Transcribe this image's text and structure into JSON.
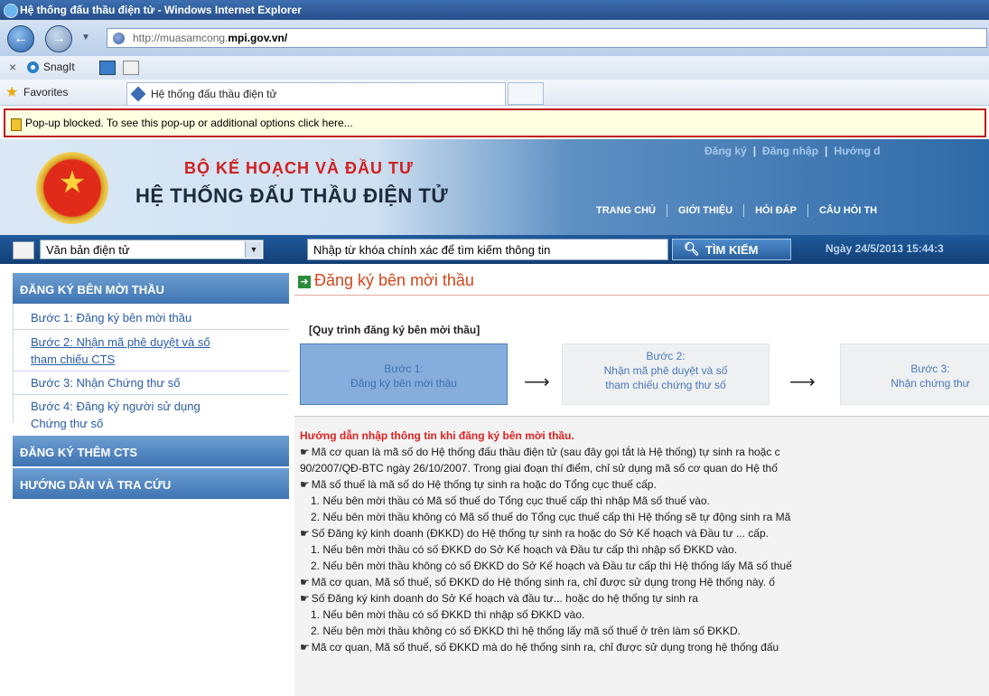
{
  "window": {
    "title": "Hệ thống đấu thầu điện tử - Windows Internet Explorer"
  },
  "address": {
    "url_prefix": "http://muasamcong.",
    "url_domain": "mpi.gov.vn/"
  },
  "toolbar": {
    "close": "×",
    "snagit": "SnagIt"
  },
  "favorites": {
    "label": "Favorites",
    "tab_title": "Hệ thống đấu thầu điện tử"
  },
  "infobar": {
    "message": "Pop-up blocked. To see this pop-up or additional options click here..."
  },
  "header": {
    "ministry": "BỘ KẾ HOẠCH VÀ ĐẦU TƯ",
    "system": "HỆ THỐNG ĐẤU THẦU ĐIỆN TỬ",
    "top_links": [
      "Đăng ký",
      "Đăng nhập",
      "Hướng d"
    ],
    "nav": [
      "TRANG CHỦ",
      "GIỚI THIỆU",
      "HỎI ĐÁP",
      "CÂU HỎI TH"
    ]
  },
  "search": {
    "doc_select": "Văn bản điện tử",
    "placeholder": "Nhập từ khóa chính xác để tìm kiếm thông tin",
    "button": "TÌM KIẾM",
    "datetime": "Ngày 24/5/2013 15:44:3"
  },
  "sidebar": {
    "section1": "ĐĂNG KÝ BÊN MỜI THẦU",
    "items": [
      "Bước 1: Đăng ký bên mời thầu",
      "Bước 2: Nhận mã phê duyệt và số",
      "tham chiếu CTS",
      "Bước 3: Nhận Chứng thư số",
      "Bước 4: Đăng ký người sử dụng",
      "Chứng thư số"
    ],
    "section2": "ĐĂNG KÝ THÊM CTS",
    "section3": "HƯỚNG DẪN VÀ TRA CỨU"
  },
  "content": {
    "title": "Đăng ký bên mời thầu",
    "process_label": "[Quy trình đăng ký bên mời thầu]",
    "steps": [
      {
        "line1": "Bước 1:",
        "line2": "Đăng ký bên mời thầu"
      },
      {
        "line1": "Bước 2:",
        "line2": "Nhận mã phê duyệt và số",
        "line3": "tham chiếu chứng thư số"
      },
      {
        "line1": "Bước 3:",
        "line2": "Nhận chứng thư"
      }
    ],
    "arrow": "⟶",
    "guide_title": "Hướng dẫn nhập thông tin khi đăng ký bên mời thầu.",
    "guide_lines": [
      "Mã cơ quan là mã số do Hệ thống đấu thầu điện tử (sau đây gọi tắt là Hệ thống) tự sinh ra hoặc c",
      "90/2007/QĐ-BTC ngày 26/10/2007. Trong giai đoạn thí điểm, chỉ sử dụng mã số cơ quan do Hệ thố",
      "Mã số thuế là mã số do Hệ thống tự sinh ra hoặc do Tổng cục thuế cấp.",
      "1. Nếu bên mời thầu có Mã số thuế do Tổng cục thuế cấp thì nhập Mã số thuế vào.",
      "2. Nếu bên mời thầu không có Mã số thuế do Tổng cục thuế cấp thì Hệ thống sẽ tự động sinh ra Mã",
      "Số Đăng ký kinh doanh (ĐKKD) do Hệ thống tự sinh ra hoặc do Sở Kế hoạch và Đầu tư ... cấp.",
      "1. Nếu bên mời thầu có số ĐKKD do Sở Kế hoạch và Đầu tư cấp thì nhập số ĐKKD vào.",
      "2. Nếu bên mời thầu không có số ĐKKD do Sở Kế hoạch và Đầu tư cấp thì Hệ thống lấy Mã số thuế",
      "Mã cơ quan, Mã số thuế, số ĐKKD do Hệ thống sinh ra, chỉ được sử dụng trong Hệ thống này. ố",
      "Số Đăng ký kinh doanh do Sở Kế hoạch và đầu tư... hoặc do hệ thống tự sinh ra",
      "1. Nếu bên mời thầu có số ĐKKD thì nhập số ĐKKD vào.",
      "2. Nếu bên mời thầu không có số ĐKKD thì hệ thống lấy mã số thuế ở trên làm số ĐKKD.",
      "Mã cơ quan, Mã số thuế, số ĐKKD mà do hệ thống sinh ra, chỉ được sử dụng trong hệ thống đấu"
    ]
  }
}
